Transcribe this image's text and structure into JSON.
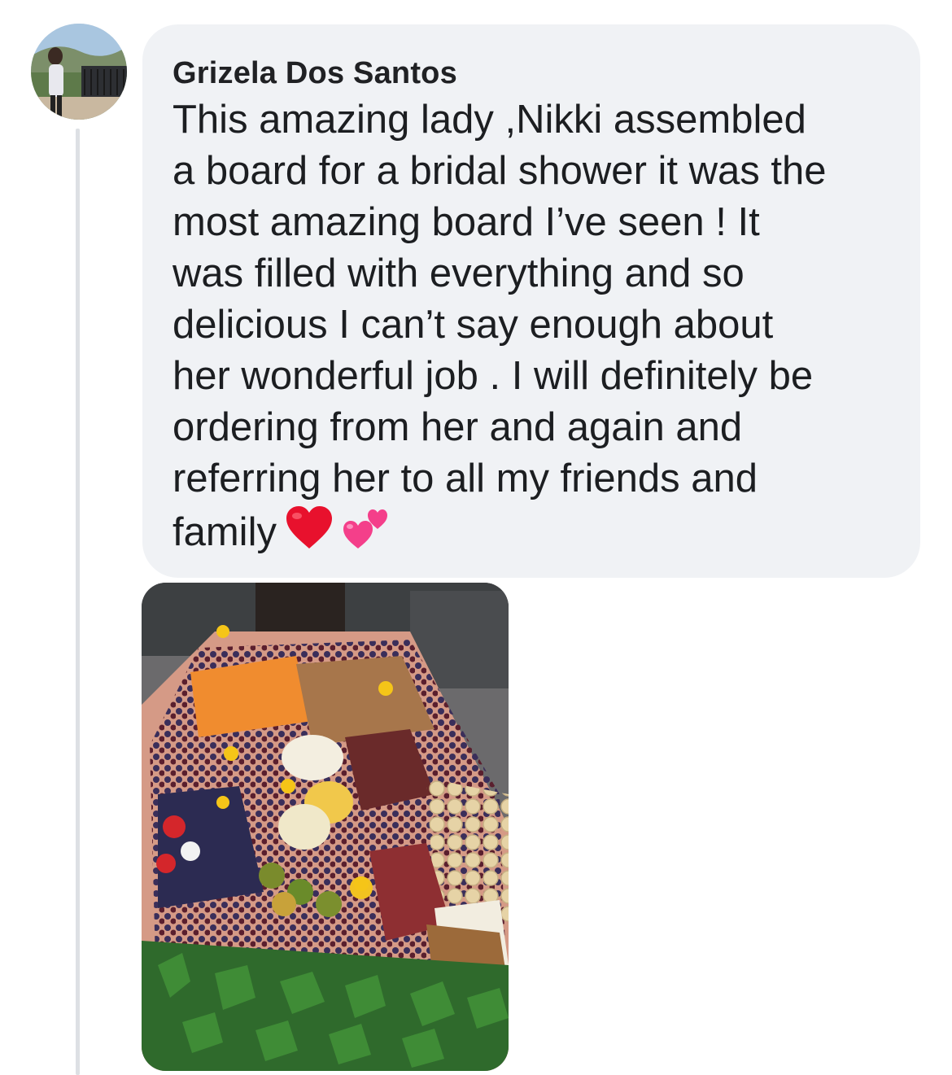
{
  "comment": {
    "author_name": "Grizela Dos Santos",
    "text": "This amazing lady ,Nikki assembled\na board for a bridal shower it was the\nmost amazing board I’ve seen ! It\nwas filled with everything and so\ndelicious I can’t say enough about\nher wonderful job . I will definitely be\nordering from her and again and\nreferring her to all my friends and\nfamily",
    "emojis": [
      "red-heart-emoji",
      "two-hearts-emoji"
    ],
    "attachment": {
      "type": "photo"
    }
  },
  "colors": {
    "bubble_background": "#f0f2f5",
    "thread_line": "#dde0e4",
    "text": "#1c1e21",
    "heart_red": "#e8112d",
    "heart_pink": "#f43f8a"
  }
}
